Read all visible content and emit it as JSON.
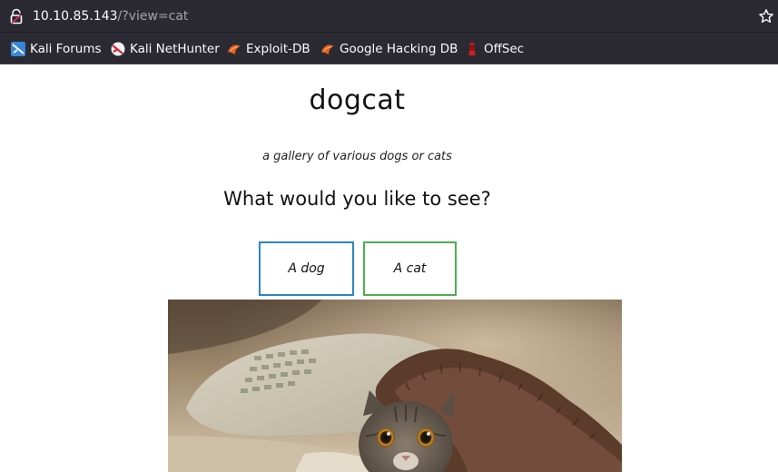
{
  "browser": {
    "url_host": "10.10.85.143",
    "url_path": "/?view=cat",
    "icons": {
      "lock": "lock-icon",
      "bookmark_star": "star-icon"
    },
    "bookmarks": [
      {
        "label": "Kali Forums",
        "icon": "kali-forums-icon"
      },
      {
        "label": "Kali NetHunter",
        "icon": "kali-nethunter-icon"
      },
      {
        "label": "Exploit-DB",
        "icon": "exploit-db-icon"
      },
      {
        "label": "Google Hacking DB",
        "icon": "google-hacking-db-icon"
      },
      {
        "label": "OffSec",
        "icon": "offsec-icon"
      }
    ]
  },
  "page": {
    "title": "dogcat",
    "subtitle": "a gallery of various dogs or cats",
    "question": "What would you like to see?",
    "buttons": [
      {
        "label": "A dog",
        "color": "#2a86c4"
      },
      {
        "label": "A cat",
        "color": "#4caf50"
      }
    ],
    "image": {
      "subject": "kitten peeking out from under a fuzzy blanket on a pillow"
    }
  },
  "colors": {
    "chrome_bg": "#2b2a33",
    "chrome_text": "#fbfbfe",
    "url_path_text": "#a5a4ad",
    "page_bg": "#ffffff"
  }
}
